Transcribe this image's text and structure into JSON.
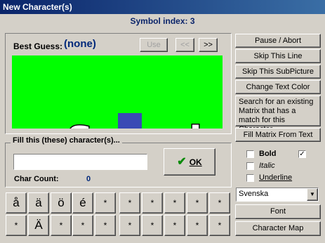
{
  "window": {
    "title": "New Character(s)"
  },
  "symbol_index": "Symbol index: 3",
  "best_guess": {
    "label": "Best Guess:",
    "value": "(none)",
    "use_label": "Use",
    "prev_label": "<<",
    "next_label": ">>"
  },
  "preview": {
    "text": "Svensk Te",
    "bg": "#00ff00"
  },
  "fill": {
    "group_title": "Fill this (these) character(s)...",
    "value": "",
    "char_count_label": "Char Count:",
    "char_count": "0",
    "ok_label": "OK"
  },
  "actions": {
    "pause": "Pause / Abort",
    "skip_line": "Skip This Line",
    "skip_subpicture": "Skip This SubPicture",
    "change_color": "Change Text Color",
    "search_matrix": "Search for an existing Matrix that has a match for this Character",
    "fill_matrix": "Fill Matrix From Text"
  },
  "style": {
    "bold": "Bold",
    "italic": "Italic",
    "underline": "Underline",
    "bold_extra_checked": true
  },
  "language": {
    "selected": "Svenska"
  },
  "font_button": "Font",
  "charmap_button": "Character Map",
  "keys": {
    "row1": [
      "å",
      "ä",
      "ö",
      "é",
      "*",
      "*",
      "*",
      "*",
      "*",
      "*"
    ],
    "row2": [
      "*",
      "Ä",
      "*",
      "*",
      "*",
      "*",
      "*",
      "*",
      "*",
      "*"
    ]
  }
}
